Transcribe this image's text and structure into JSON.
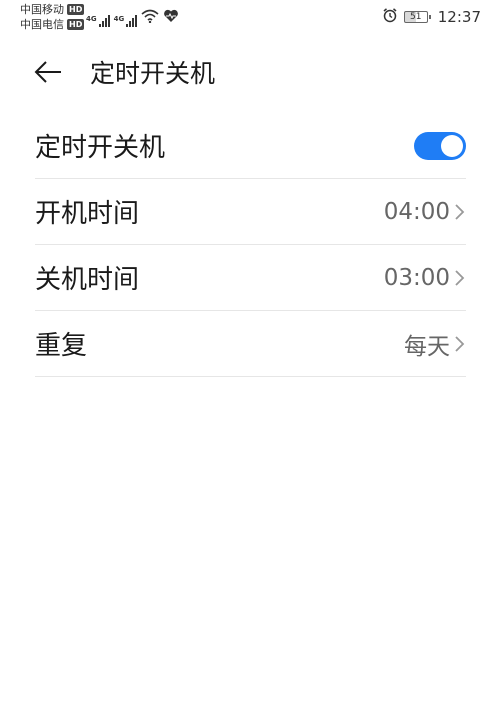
{
  "status_bar": {
    "carrier_1": "中国移动",
    "carrier_2": "中国电信",
    "hd_badge": "HD",
    "network_1": "4G",
    "network_2": "4G",
    "battery_level": "51",
    "time": "12:37",
    "icons": [
      "signal-icon",
      "signal-icon",
      "wifi-icon",
      "heart-icon",
      "alarm-icon",
      "battery-icon"
    ]
  },
  "header": {
    "title": "定时开关机"
  },
  "settings": {
    "items": [
      {
        "label": "定时开关机",
        "type": "toggle",
        "enabled": true
      },
      {
        "label": "开机时间",
        "value": "04:00"
      },
      {
        "label": "关机时间",
        "value": "03:00"
      },
      {
        "label": "重复",
        "value": "每天"
      }
    ]
  },
  "colors": {
    "accent": "#1f7df5",
    "text_primary": "#1a1a1a",
    "text_secondary": "#666666",
    "divider": "#e6e6e6"
  }
}
